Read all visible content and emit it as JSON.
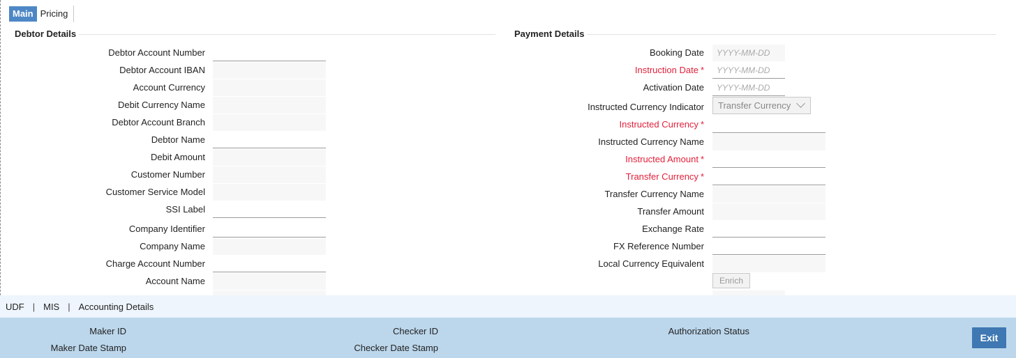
{
  "tabs": [
    {
      "label": "Main",
      "active": true
    },
    {
      "label": "Pricing",
      "active": false
    }
  ],
  "debtor_section": {
    "title": "Debtor Details",
    "fields": [
      {
        "label": "Debtor Account Number",
        "required": false,
        "kind": "editable"
      },
      {
        "label": "Debtor Account IBAN",
        "required": false,
        "kind": "readonly"
      },
      {
        "label": "Account Currency",
        "required": false,
        "kind": "readonly"
      },
      {
        "label": "Debit Currency Name",
        "required": false,
        "kind": "readonly"
      },
      {
        "label": "Debtor Account Branch",
        "required": false,
        "kind": "readonly"
      },
      {
        "label": "Debtor Name",
        "required": false,
        "kind": "editable"
      },
      {
        "label": "Debit Amount",
        "required": false,
        "kind": "readonly"
      },
      {
        "label": "Customer Number",
        "required": false,
        "kind": "readonly"
      },
      {
        "label": "Customer Service Model",
        "required": false,
        "kind": "readonly"
      },
      {
        "label": "SSI Label",
        "required": false,
        "kind": "editable"
      },
      {
        "label": "Company Identifier",
        "required": false,
        "kind": "editable"
      },
      {
        "label": "Company Name",
        "required": false,
        "kind": "readonly"
      },
      {
        "label": "Charge Account Number",
        "required": false,
        "kind": "editable"
      },
      {
        "label": "Account Name",
        "required": false,
        "kind": "readonly"
      }
    ]
  },
  "payment_section": {
    "title": "Payment Details",
    "date_placeholder": "YYYY-MM-DD",
    "fields": [
      {
        "label": "Booking Date",
        "required": false,
        "kind": "date"
      },
      {
        "label": "Instruction Date",
        "required": true,
        "kind": "date"
      },
      {
        "label": "Activation Date",
        "required": false,
        "kind": "date"
      },
      {
        "label": "Instructed Currency Indicator",
        "required": false,
        "kind": "select"
      },
      {
        "label": "Instructed Currency",
        "required": true,
        "kind": "editable"
      },
      {
        "label": "Instructed Currency Name",
        "required": false,
        "kind": "readonly"
      },
      {
        "label": "Instructed Amount",
        "required": true,
        "kind": "editable"
      },
      {
        "label": "Transfer Currency",
        "required": true,
        "kind": "editable"
      },
      {
        "label": "Transfer Currency Name",
        "required": false,
        "kind": "readonly"
      },
      {
        "label": "Transfer Amount",
        "required": false,
        "kind": "readonly"
      },
      {
        "label": "Exchange Rate",
        "required": false,
        "kind": "editable"
      },
      {
        "label": "FX Reference Number",
        "required": false,
        "kind": "editable"
      },
      {
        "label": "Local Currency Equivalent",
        "required": false,
        "kind": "readonly"
      }
    ],
    "currency_indicator_value": "Transfer Currency",
    "enrich_label": "Enrich"
  },
  "link_bar": {
    "links": [
      "UDF",
      "MIS",
      "Accounting Details"
    ],
    "separator": "|"
  },
  "footer": {
    "maker_id": "Maker ID",
    "maker_date_stamp": "Maker Date Stamp",
    "checker_id": "Checker ID",
    "checker_date_stamp": "Checker Date Stamp",
    "authorization_status": "Authorization Status",
    "exit_label": "Exit"
  },
  "colors": {
    "tab_active": "#4e87c6",
    "required_label": "#e2203a",
    "footer_bg": "#bcd7ec",
    "link_bar_bg": "#eef5fc",
    "exit_button": "#3f78b2"
  }
}
